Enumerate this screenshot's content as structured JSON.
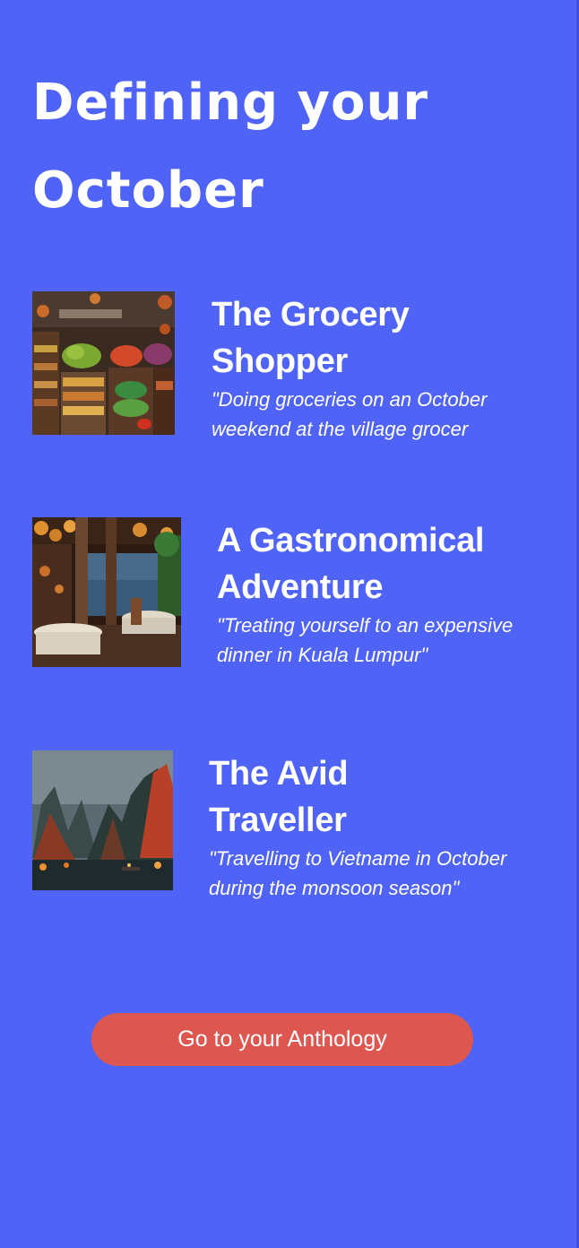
{
  "header": {
    "title": "Defining your October"
  },
  "cards": [
    {
      "title": "The Grocery Shopper",
      "description": "\"Doing groceries on an October weekend at the village grocer",
      "image_icon": "grocery-store-illustration"
    },
    {
      "title": "A Gastronomical Adventure",
      "description": "\"Treating yourself to an expensive dinner in Kuala Lumpur\"",
      "image_icon": "restaurant-illustration"
    },
    {
      "title": "The Avid Traveller",
      "description": "\"Travelling to Vietname in October during the monsoon season\"",
      "image_icon": "mountain-bay-illustration"
    }
  ],
  "cta": {
    "label": "Go to your Anthology"
  },
  "colors": {
    "background": "#5063f7",
    "button": "#dd5750",
    "text": "#ffffff"
  }
}
